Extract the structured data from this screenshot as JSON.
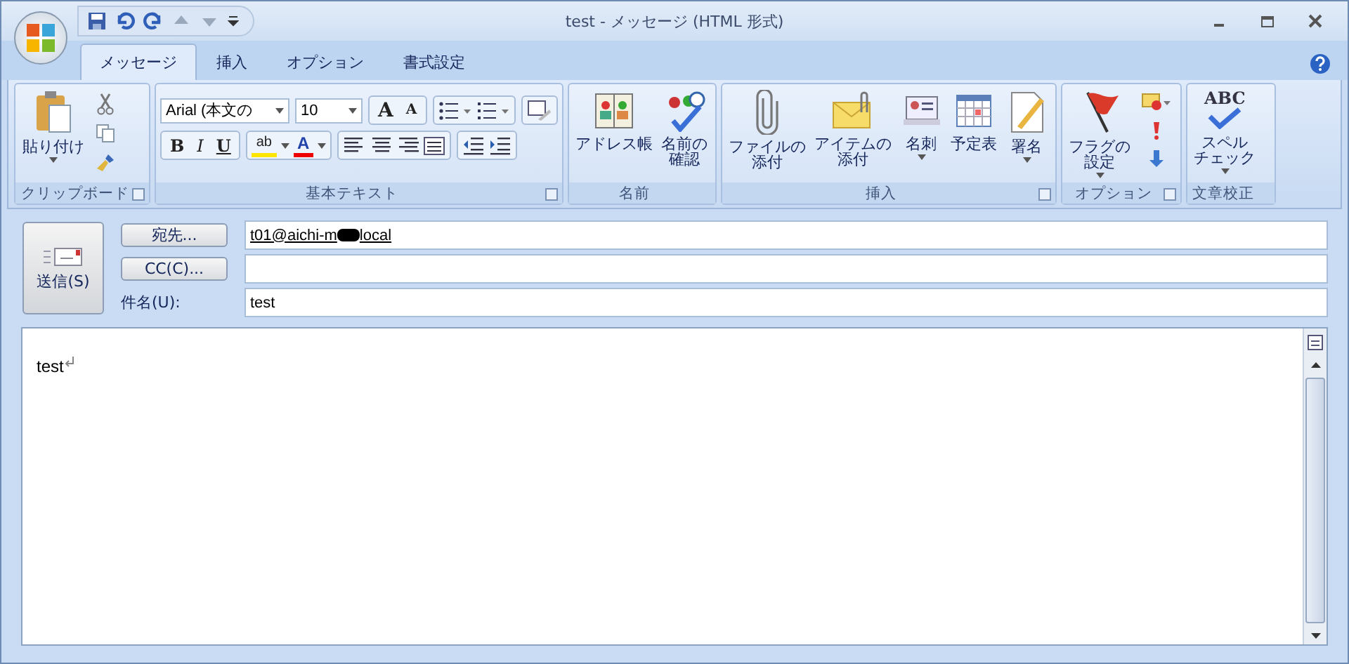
{
  "window": {
    "title": "test - メッセージ (HTML 形式)"
  },
  "tabs": [
    {
      "label": "メッセージ",
      "selected": true
    },
    {
      "label": "挿入",
      "selected": false
    },
    {
      "label": "オプション",
      "selected": false
    },
    {
      "label": "書式設定",
      "selected": false
    }
  ],
  "clipboard": {
    "label": "クリップボード",
    "paste": "貼り付け"
  },
  "basic_text": {
    "label": "基本テキスト",
    "font": "Arial (本文の",
    "size": "10",
    "grow": "A",
    "shrink": "A",
    "bold": "B",
    "italic": "I",
    "underline": "U",
    "highlight": "ab",
    "font_color": "A"
  },
  "groups": [
    {
      "label": "名前",
      "launcher": false,
      "items": [
        {
          "kind": "address-book",
          "lines": [
            "アドレス帳"
          ],
          "dropdown": false
        },
        {
          "kind": "check-names",
          "lines": [
            "名前の",
            "確認"
          ],
          "dropdown": false
        }
      ]
    },
    {
      "label": "挿入",
      "launcher": true,
      "items": [
        {
          "kind": "attach-file",
          "lines": [
            "ファイルの",
            "添付"
          ],
          "dropdown": false
        },
        {
          "kind": "attach-item",
          "lines": [
            "アイテムの",
            "添付"
          ],
          "dropdown": false
        },
        {
          "kind": "card",
          "lines": [
            "名刺"
          ],
          "dropdown": true
        },
        {
          "kind": "calendar",
          "lines": [
            "予定表"
          ],
          "dropdown": false
        },
        {
          "kind": "signature",
          "lines": [
            "署名"
          ],
          "dropdown": true
        }
      ]
    },
    {
      "label": "オプション",
      "launcher": true,
      "items": [
        {
          "kind": "flag",
          "lines": [
            "フラグの",
            "設定"
          ],
          "dropdown": true
        },
        {
          "kind": "small-stack"
        }
      ]
    },
    {
      "label": "文章校正",
      "launcher": false,
      "items": [
        {
          "kind": "spelling",
          "icon_text": "ABC",
          "lines": [
            "スペル",
            "チェック"
          ],
          "dropdown": true
        }
      ]
    }
  ],
  "header": {
    "send": "送信(S)",
    "to_button": "宛先...",
    "to_value_start": "t01@aichi-m",
    "to_value_end": "local",
    "cc_button": "CC(C)...",
    "subject_label": "件名(U):",
    "subject_value": "test"
  },
  "body": {
    "text": "test"
  }
}
